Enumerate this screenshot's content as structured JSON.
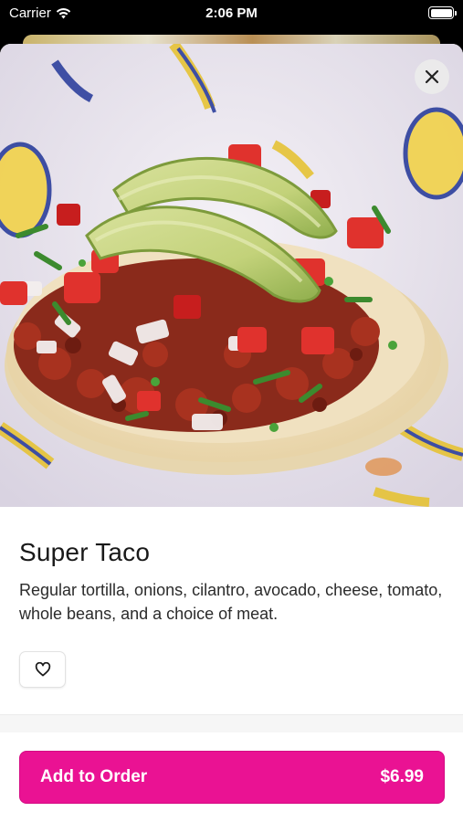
{
  "status_bar": {
    "carrier": "Carrier",
    "time": "2:06 PM",
    "icons": [
      "wifi-icon",
      "battery-icon"
    ]
  },
  "item": {
    "title": "Super Taco",
    "description": "Regular tortilla, onions, cilantro, avocado, cheese, tomato, whole beans, and a choice of meat.",
    "image_icon": "taco-photo",
    "close_icon": "close-icon",
    "favorite_icon": "heart-icon"
  },
  "order_button": {
    "label": "Add to Order",
    "price": "$6.99"
  },
  "colors": {
    "accent": "#ea1293",
    "text": "#191919"
  }
}
